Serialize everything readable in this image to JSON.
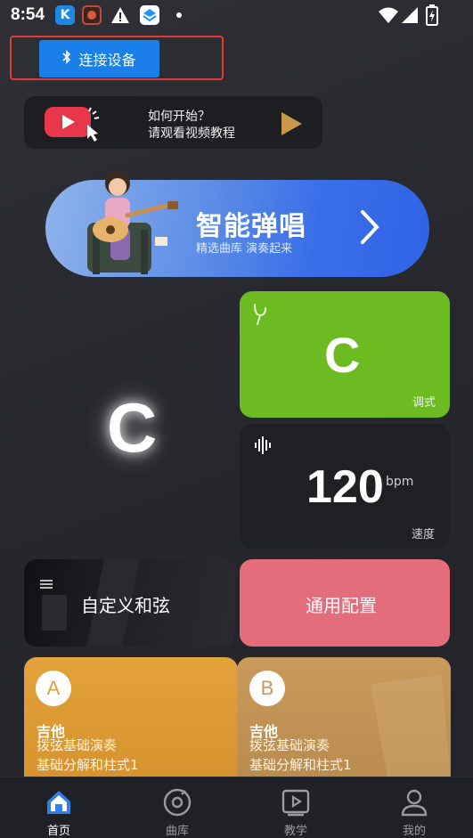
{
  "status_bar": {
    "time": "8:54",
    "icons": [
      "kuaishou-icon",
      "app-icon",
      "warning-icon",
      "layers-icon",
      "dot-icon",
      "wifi-icon",
      "signal-icon",
      "battery-charging-icon"
    ]
  },
  "header": {
    "connect_label": "连接设备",
    "connect_icon": "bluetooth-icon"
  },
  "tutorial": {
    "line1": "如何开始？",
    "line2": "请观看视频教程"
  },
  "banner": {
    "title": "智能弹唱",
    "subtitle": "精选曲库 演奏起来"
  },
  "chord": {
    "current": "C"
  },
  "tune": {
    "value": "C",
    "label": "调式"
  },
  "speed": {
    "value": "120",
    "unit": "bpm",
    "label": "速度"
  },
  "tiles": {
    "custom_chord": "自定义和弦",
    "general_config": "通用配置"
  },
  "courses": [
    {
      "badge": "A",
      "name": "吉他",
      "line1": "拨弦基础演奏",
      "line2": "基础分解和柱式1"
    },
    {
      "badge": "B",
      "name": "吉他",
      "line1": "拨弦基础演奏",
      "line2": "基础分解和柱式1"
    }
  ],
  "nav": [
    {
      "label": "首页",
      "icon": "home-icon",
      "active": true
    },
    {
      "label": "曲库",
      "icon": "disc-icon",
      "active": false
    },
    {
      "label": "教学",
      "icon": "video-icon",
      "active": false
    },
    {
      "label": "我的",
      "icon": "user-icon",
      "active": false
    }
  ],
  "colors": {
    "background": "#27282e",
    "connect_button": "#1a7fe8",
    "highlight_frame": "#e23b35",
    "tune_card": "#6bbb21",
    "config_card": "#e36d7a",
    "course_a": "#e3a23a",
    "course_b": "#c99a5a",
    "banner": "#3a6ee8",
    "tutorial_play": "#c8974a"
  }
}
